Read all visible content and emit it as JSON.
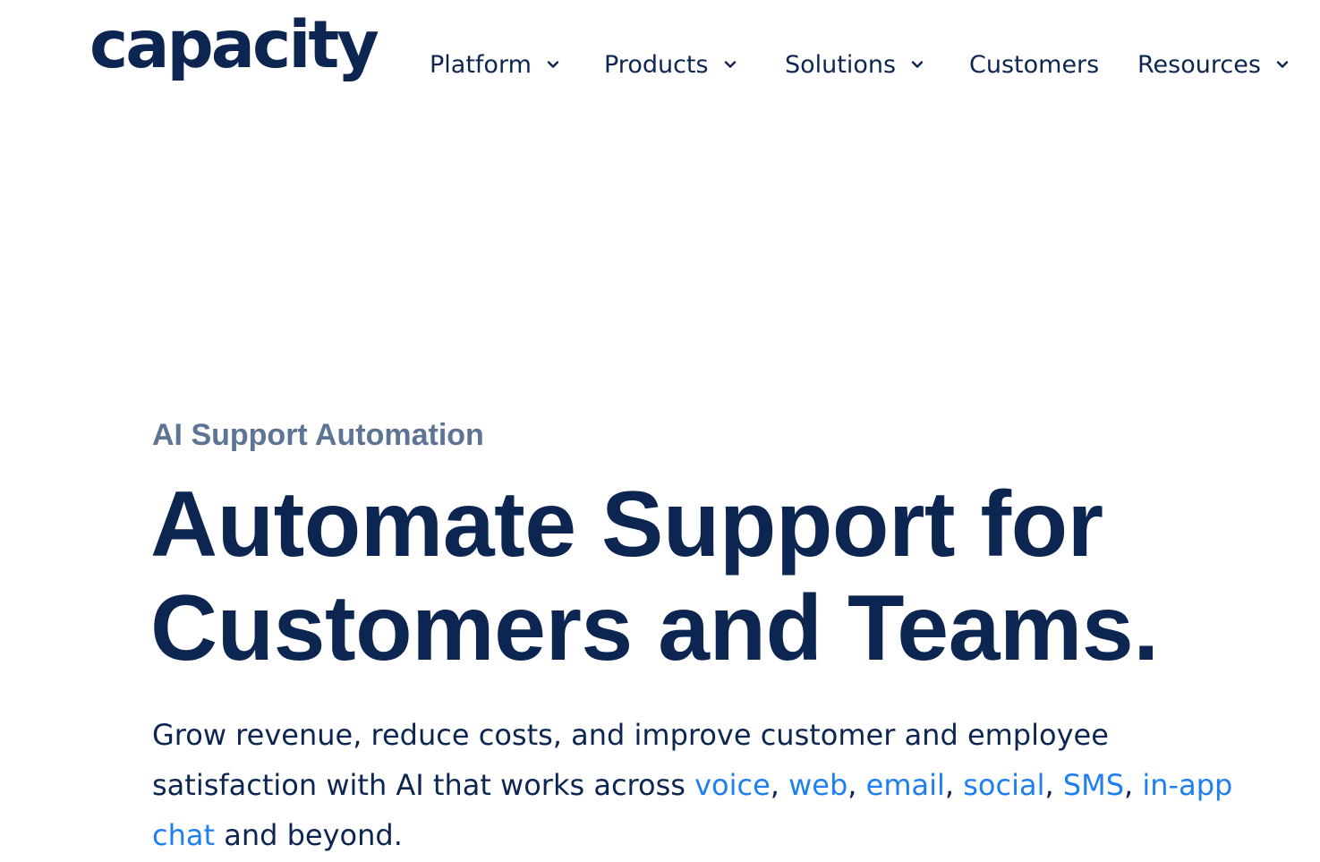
{
  "brand": {
    "logo_text": "capacity"
  },
  "nav": {
    "items": [
      {
        "label": "Platform",
        "dropdown": true
      },
      {
        "label": "Products",
        "dropdown": true
      },
      {
        "label": "Solutions",
        "dropdown": true
      },
      {
        "label": "Customers",
        "dropdown": false
      },
      {
        "label": "Resources",
        "dropdown": true
      }
    ],
    "chevron_icon": "chevron-down-icon"
  },
  "hero": {
    "eyebrow": "AI Support Automation",
    "headline_line1": "Automate Support for",
    "headline_line2": "Customers and Teams.",
    "description": {
      "line1": "Grow revenue, reduce costs, and improve customer and employee",
      "line2_prefix": "satisfaction with AI that works across ",
      "channels": [
        "voice",
        "web",
        "email",
        "social",
        "SMS",
        "in-app"
      ],
      "line3_link": "chat",
      "line3_suffix": " and beyond.",
      "separator": ", "
    }
  },
  "colors": {
    "brand_navy": "#0c2651",
    "eyebrow_gray": "#5e7494",
    "link_blue": "#1e80f0",
    "background": "#ffffff"
  }
}
